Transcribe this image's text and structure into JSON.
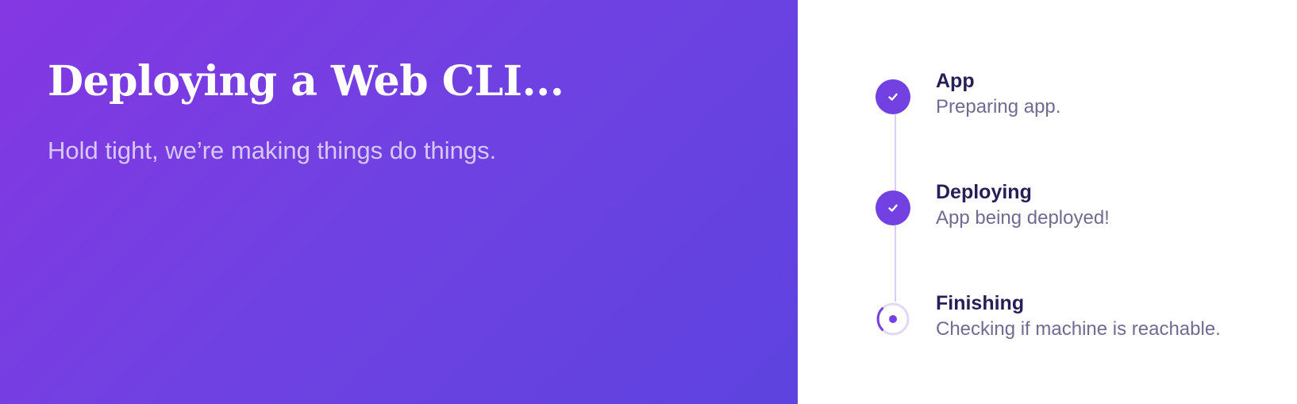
{
  "hero": {
    "title": "Deploying a Web CLI...",
    "subtitle": "Hold tight, we’re making things do things."
  },
  "steps": [
    {
      "title": "App",
      "description": "Preparing app.",
      "status": "complete",
      "icon": "check-icon"
    },
    {
      "title": "Deploying",
      "description": "App being deployed!",
      "status": "complete",
      "icon": "check-icon"
    },
    {
      "title": "Finishing",
      "description": "Checking if machine is reachable.",
      "status": "in-progress",
      "icon": "spinner-icon"
    }
  ],
  "colors": {
    "gradient_start": "#8437e2",
    "gradient_end": "#5d43df",
    "accent": "#7340e1",
    "title_text": "#241f57",
    "muted_text": "#6f6b91",
    "track": "#d9cdf3"
  }
}
